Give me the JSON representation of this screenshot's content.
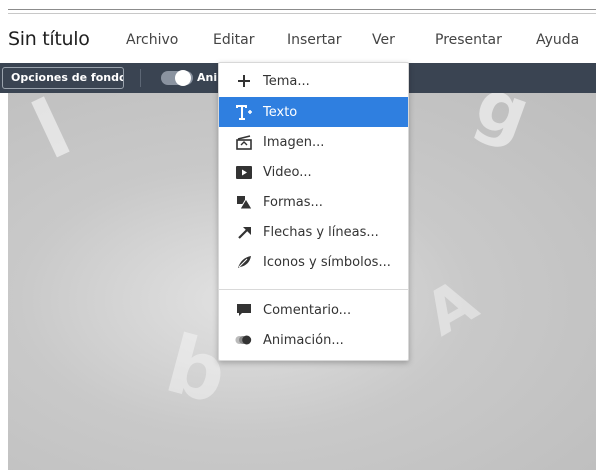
{
  "app": {
    "doc_title": "Sin título"
  },
  "menubar": {
    "items": [
      "Archivo",
      "Editar",
      "Insertar",
      "Ver",
      "Presentar",
      "Ayuda"
    ]
  },
  "toolbar": {
    "background_options_label": "Opciones de fondo",
    "animation_toggle_label": "Animación",
    "animation_toggle_on": true
  },
  "insert_menu": {
    "open": true,
    "selected_index": 1,
    "items": [
      {
        "label": "Tema...",
        "icon": "plus-icon"
      },
      {
        "label": "Texto",
        "icon": "text-icon"
      },
      {
        "label": "Imagen...",
        "icon": "image-icon"
      },
      {
        "label": "Video...",
        "icon": "video-icon"
      },
      {
        "label": "Formas...",
        "icon": "shapes-icon"
      },
      {
        "label": "Flechas y líneas...",
        "icon": "arrow-icon"
      },
      {
        "label": "Iconos y símbolos...",
        "icon": "leaf-icon"
      },
      {
        "label": "Comentario...",
        "icon": "comment-icon"
      },
      {
        "label": "Animación...",
        "icon": "animation-icon"
      }
    ]
  },
  "colors": {
    "toolbar_bg": "#3a4452",
    "selected_bg": "#2f7fe0"
  }
}
